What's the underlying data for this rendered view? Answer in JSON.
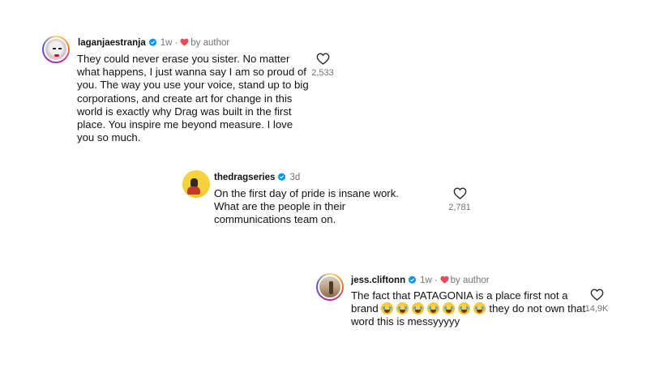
{
  "comments": [
    {
      "username": "laganjaestranja",
      "verified": true,
      "time": "1w",
      "separator": "·",
      "by_author": "by author",
      "text": "They could never erase you sister. No matter what happens, I just wanna say I am so proud of you. The way you use your voice, stand up to big corporations, and create art for change in this world is exactly why Drag was built in the first place. You inspire me beyond measure. I love you so much.",
      "likes": "2,533"
    },
    {
      "username": "thedragseries",
      "verified": true,
      "time": "3d",
      "text": "On the first day of pride is insane work. What are the people in their communications team on.",
      "likes": "2,781"
    },
    {
      "username": "jess.cliftonn",
      "verified": true,
      "time": "1w",
      "separator": "·",
      "by_author": "by author",
      "text_before": "The fact that PATAGONIA is a place first not a brand",
      "emoji_count": 7,
      "emoji_name": "loudly-crying-face",
      "text_after": "they do not own that word this is messyyyyy",
      "likes": "14,9K"
    }
  ],
  "colors": {
    "verified": "#0095f6",
    "heart_red": "#ed4956",
    "muted": "#737373"
  }
}
